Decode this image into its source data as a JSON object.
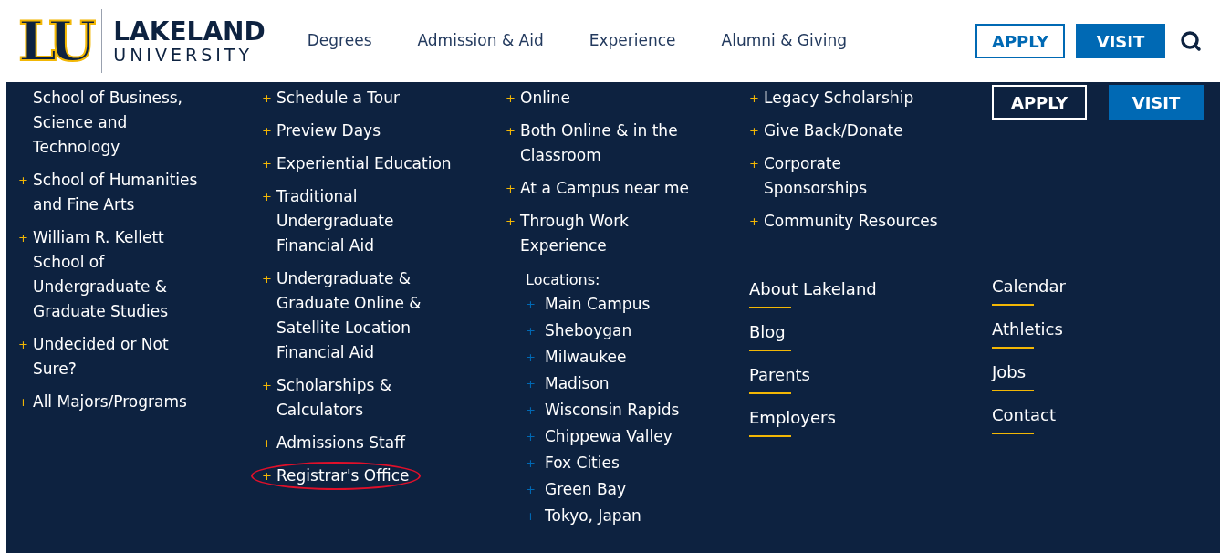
{
  "header": {
    "logo": {
      "monogram": "LU",
      "name": "LAKELAND",
      "subname": "UNIVERSITY"
    },
    "nav": [
      "Degrees",
      "Admission & Aid",
      "Experience",
      "Alumni & Giving"
    ],
    "buttons": [
      {
        "label": "APPLY",
        "kind": "outline"
      },
      {
        "label": "VISIT",
        "kind": "solid"
      }
    ]
  },
  "menu": {
    "columns": [
      {
        "links": [
          {
            "label": "School of Business, Science and Technology",
            "highlighted": false
          },
          {
            "marker": "+",
            "label": "School of Humanities and Fine Arts",
            "highlighted": false
          },
          {
            "marker": "+",
            "label": "William R. Kellett School of Undergraduate & Graduate Studies",
            "highlighted": false
          },
          {
            "marker": "+",
            "label": "Undecided or Not Sure?",
            "highlighted": false
          },
          {
            "marker": "+",
            "label": "All Majors/Programs",
            "highlighted": false
          }
        ]
      },
      {
        "links": [
          {
            "marker": "+",
            "label": "Schedule a Tour",
            "highlighted": false
          },
          {
            "marker": "+",
            "label": "Preview Days",
            "highlighted": false
          },
          {
            "marker": "+",
            "label": "Experiential Education",
            "highlighted": false
          },
          {
            "marker": "+",
            "label": "Traditional Undergraduate Financial Aid",
            "highlighted": false
          },
          {
            "marker": "+",
            "label": "Undergraduate & Graduate Online & Satellite Location Financial Aid",
            "highlighted": false
          },
          {
            "marker": "+",
            "label": "Scholarships & Calculators",
            "highlighted": false
          },
          {
            "marker": "+",
            "label": "Admissions Staff",
            "highlighted": false
          },
          {
            "marker": "+",
            "label": "Registrar's Office",
            "highlighted": true
          }
        ]
      },
      {
        "links": [
          {
            "marker": "+",
            "label": "Online",
            "highlighted": false
          },
          {
            "marker": "+",
            "label": "Both Online & in the Classroom",
            "highlighted": false
          },
          {
            "marker": "+",
            "label": "At a Campus near me",
            "highlighted": false
          },
          {
            "marker": "+",
            "label": "Through Work Experience",
            "highlighted": false
          }
        ],
        "locations_label": "Locations:",
        "locations": [
          {
            "marker": "+",
            "label": "Main Campus"
          },
          {
            "marker": "+",
            "label": "Sheboygan"
          },
          {
            "marker": "+",
            "label": "Milwaukee"
          },
          {
            "marker": "+",
            "label": "Madison"
          },
          {
            "marker": "+",
            "label": "Wisconsin Rapids"
          },
          {
            "marker": "+",
            "label": "Chippewa Valley"
          },
          {
            "marker": "+",
            "label": "Fox Cities"
          },
          {
            "marker": "+",
            "label": "Green Bay"
          },
          {
            "marker": "+",
            "label": "Tokyo, Japan"
          }
        ]
      },
      {
        "links": [
          {
            "marker": "+",
            "label": "Legacy Scholarship",
            "highlighted": false
          },
          {
            "marker": "+",
            "label": "Give Back/Donate",
            "highlighted": false
          },
          {
            "marker": "+",
            "label": "Corporate Sponsorships",
            "highlighted": false
          },
          {
            "marker": "+",
            "label": "Community Resources",
            "highlighted": false
          }
        ],
        "footer_links": [
          "About Lakeland",
          "Blog",
          "Parents",
          "Employers"
        ]
      },
      {
        "buttons": [
          {
            "label": "APPLY",
            "kind": "outline"
          },
          {
            "label": "VISIT",
            "kind": "solid"
          }
        ],
        "footer_links": [
          "Calendar",
          "Athletics",
          "Jobs",
          "Contact"
        ]
      }
    ]
  }
}
